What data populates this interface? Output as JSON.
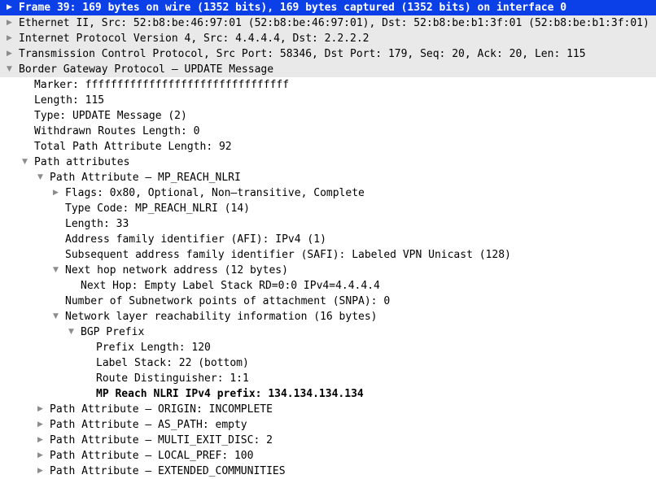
{
  "app": {
    "name": "wireshark-packet-details",
    "panel": "packet-detail-tree"
  },
  "colors": {
    "selection_background": "#0b3fe8",
    "selection_text": "#ffffff",
    "shaded_row_background": "#e9e9e9",
    "row_background": "#ffffff",
    "text": "#000000",
    "twisty": "#8c8c8c"
  },
  "icons": {
    "collapsed": "▶",
    "expanded": "▼"
  },
  "tree": {
    "rows": [
      {
        "id": "frame",
        "name": "tree-row-frame",
        "depth": 0,
        "state": "collapsed",
        "selected": true,
        "shaded": false,
        "emphasis": true,
        "text": "Frame 39: 169 bytes on wire (1352 bits), 169 bytes captured (1352 bits) on interface 0"
      },
      {
        "id": "ethernet",
        "name": "tree-row-ethernet",
        "depth": 0,
        "state": "collapsed",
        "selected": false,
        "shaded": true,
        "emphasis": false,
        "text": "Ethernet II, Src: 52:b8:be:46:97:01 (52:b8:be:46:97:01), Dst: 52:b8:be:b1:3f:01 (52:b8:be:b1:3f:01)"
      },
      {
        "id": "ipv4",
        "name": "tree-row-ipv4",
        "depth": 0,
        "state": "collapsed",
        "selected": false,
        "shaded": true,
        "emphasis": false,
        "text": "Internet Protocol Version 4, Src: 4.4.4.4, Dst: 2.2.2.2"
      },
      {
        "id": "tcp",
        "name": "tree-row-tcp",
        "depth": 0,
        "state": "collapsed",
        "selected": false,
        "shaded": true,
        "emphasis": false,
        "text": "Transmission Control Protocol, Src Port: 58346, Dst Port: 179, Seq: 20, Ack: 20, Len: 115"
      },
      {
        "id": "bgp",
        "name": "tree-row-bgp-update-message",
        "depth": 0,
        "state": "expanded",
        "selected": false,
        "shaded": true,
        "emphasis": false,
        "text": "Border Gateway Protocol – UPDATE Message"
      },
      {
        "id": "marker",
        "name": "tree-row-marker",
        "depth": 1,
        "state": "leaf",
        "selected": false,
        "shaded": false,
        "emphasis": false,
        "text": "Marker: ffffffffffffffffffffffffffffffff"
      },
      {
        "id": "length",
        "name": "tree-row-length",
        "depth": 1,
        "state": "leaf",
        "selected": false,
        "shaded": false,
        "emphasis": false,
        "text": "Length: 115"
      },
      {
        "id": "type",
        "name": "tree-row-type",
        "depth": 1,
        "state": "leaf",
        "selected": false,
        "shaded": false,
        "emphasis": false,
        "text": "Type: UPDATE Message (2)"
      },
      {
        "id": "withdrawn-routes-length",
        "name": "tree-row-withdrawn-routes-length",
        "depth": 1,
        "state": "leaf",
        "selected": false,
        "shaded": false,
        "emphasis": false,
        "text": "Withdrawn Routes Length: 0"
      },
      {
        "id": "total-path-attribute-length",
        "name": "tree-row-total-path-attribute-length",
        "depth": 1,
        "state": "leaf",
        "selected": false,
        "shaded": false,
        "emphasis": false,
        "text": "Total Path Attribute Length: 92"
      },
      {
        "id": "path-attributes",
        "name": "tree-row-path-attributes",
        "depth": 1,
        "state": "expanded",
        "selected": false,
        "shaded": false,
        "emphasis": false,
        "text": "Path attributes"
      },
      {
        "id": "pa-mp-reach-nlri",
        "name": "tree-row-path-attribute-mp-reach-nlri",
        "depth": 2,
        "state": "expanded",
        "selected": false,
        "shaded": false,
        "emphasis": false,
        "text": "Path Attribute – MP_REACH_NLRI"
      },
      {
        "id": "flags",
        "name": "tree-row-flags",
        "depth": 3,
        "state": "collapsed",
        "selected": false,
        "shaded": false,
        "emphasis": false,
        "text": "Flags: 0x80, Optional, Non–transitive, Complete"
      },
      {
        "id": "type-code",
        "name": "tree-row-type-code",
        "depth": 3,
        "state": "leaf",
        "selected": false,
        "shaded": false,
        "emphasis": false,
        "text": "Type Code: MP_REACH_NLRI (14)"
      },
      {
        "id": "attr-length",
        "name": "tree-row-attribute-length",
        "depth": 3,
        "state": "leaf",
        "selected": false,
        "shaded": false,
        "emphasis": false,
        "text": "Length: 33"
      },
      {
        "id": "afi",
        "name": "tree-row-address-family-identifier",
        "depth": 3,
        "state": "leaf",
        "selected": false,
        "shaded": false,
        "emphasis": false,
        "text": "Address family identifier (AFI): IPv4 (1)"
      },
      {
        "id": "safi",
        "name": "tree-row-subsequent-address-family-identifier",
        "depth": 3,
        "state": "leaf",
        "selected": false,
        "shaded": false,
        "emphasis": false,
        "text": "Subsequent address family identifier (SAFI): Labeled VPN Unicast (128)"
      },
      {
        "id": "next-hop-network-address",
        "name": "tree-row-next-hop-network-address",
        "depth": 3,
        "state": "expanded",
        "selected": false,
        "shaded": false,
        "emphasis": false,
        "text": "Next hop network address (12 bytes)"
      },
      {
        "id": "next-hop",
        "name": "tree-row-next-hop",
        "depth": 4,
        "state": "leaf",
        "selected": false,
        "shaded": false,
        "emphasis": false,
        "text": "Next Hop: Empty Label Stack RD=0:0 IPv4=4.4.4.4"
      },
      {
        "id": "snpa",
        "name": "tree-row-snpa-count",
        "depth": 3,
        "state": "leaf",
        "selected": false,
        "shaded": false,
        "emphasis": false,
        "text": "Number of Subnetwork points of attachment (SNPA): 0"
      },
      {
        "id": "nlri",
        "name": "tree-row-network-layer-reachability-information",
        "depth": 3,
        "state": "expanded",
        "selected": false,
        "shaded": false,
        "emphasis": false,
        "text": "Network layer reachability information (16 bytes)"
      },
      {
        "id": "bgp-prefix",
        "name": "tree-row-bgp-prefix",
        "depth": 4,
        "state": "expanded",
        "selected": false,
        "shaded": false,
        "emphasis": false,
        "text": "BGP Prefix"
      },
      {
        "id": "prefix-length",
        "name": "tree-row-prefix-length",
        "depth": 5,
        "state": "leaf",
        "selected": false,
        "shaded": false,
        "emphasis": false,
        "text": "Prefix Length: 120"
      },
      {
        "id": "label-stack",
        "name": "tree-row-label-stack",
        "depth": 5,
        "state": "leaf",
        "selected": false,
        "shaded": false,
        "emphasis": false,
        "text": "Label Stack: 22 (bottom)"
      },
      {
        "id": "route-distinguisher",
        "name": "tree-row-route-distinguisher",
        "depth": 5,
        "state": "leaf",
        "selected": false,
        "shaded": false,
        "emphasis": false,
        "text": "Route Distinguisher: 1:1"
      },
      {
        "id": "mp-reach-nlri-prefix",
        "name": "tree-row-mp-reach-nlri-ipv4-prefix",
        "depth": 5,
        "state": "leaf",
        "selected": false,
        "shaded": false,
        "emphasis": true,
        "text": "MP Reach NLRI IPv4 prefix: 134.134.134.134"
      },
      {
        "id": "pa-origin",
        "name": "tree-row-path-attribute-origin",
        "depth": 2,
        "state": "collapsed",
        "selected": false,
        "shaded": false,
        "emphasis": false,
        "text": "Path Attribute – ORIGIN: INCOMPLETE"
      },
      {
        "id": "pa-as-path",
        "name": "tree-row-path-attribute-as-path",
        "depth": 2,
        "state": "collapsed",
        "selected": false,
        "shaded": false,
        "emphasis": false,
        "text": "Path Attribute – AS_PATH: empty"
      },
      {
        "id": "pa-med",
        "name": "tree-row-path-attribute-multi-exit-disc",
        "depth": 2,
        "state": "collapsed",
        "selected": false,
        "shaded": false,
        "emphasis": false,
        "text": "Path Attribute – MULTI_EXIT_DISC: 2"
      },
      {
        "id": "pa-local-pref",
        "name": "tree-row-path-attribute-local-pref",
        "depth": 2,
        "state": "collapsed",
        "selected": false,
        "shaded": false,
        "emphasis": false,
        "text": "Path Attribute – LOCAL_PREF: 100"
      },
      {
        "id": "pa-extended-communities",
        "name": "tree-row-path-attribute-extended-communities",
        "depth": 2,
        "state": "collapsed",
        "selected": false,
        "shaded": false,
        "emphasis": false,
        "text": "Path Attribute – EXTENDED_COMMUNITIES"
      }
    ]
  }
}
